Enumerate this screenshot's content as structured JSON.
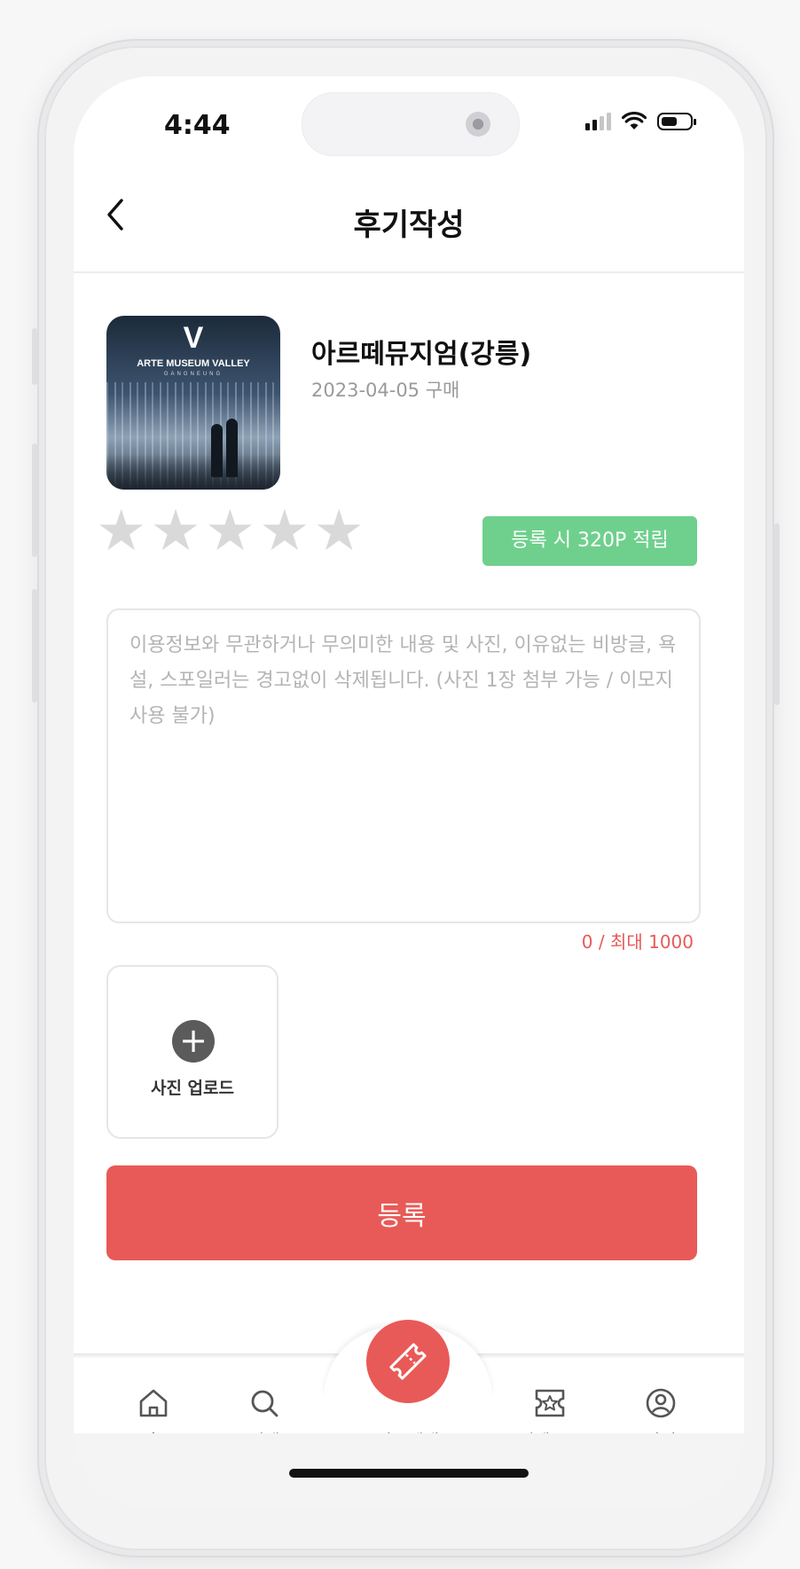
{
  "status_bar": {
    "time": "4:44"
  },
  "header": {
    "back_icon": "chevron-left-icon",
    "title": "후기작성"
  },
  "product": {
    "thumbnail_text": "ARTE MUSEUM VALLEY",
    "thumbnail_sub": "GANGNEUNG",
    "thumbnail_logo": "V",
    "name": "아르떼뮤지엄(강릉)",
    "purchase_date": "2023-04-05 구매"
  },
  "rating": {
    "stars_total": 5,
    "selected": 0,
    "star_color_empty": "#d9d9d9"
  },
  "points_badge": "등록 시 320P 적립",
  "review": {
    "placeholder": "이용정보와 무관하거나 무의미한 내용 및 사진, 이유없는 비방글, 욕설, 스포일러는 경고없이 삭제됩니다. (사진 1장 첨부 가능 / 이모지 사용 불가)",
    "char_count": "0 / 최대 1000"
  },
  "upload": {
    "icon": "plus-circle-icon",
    "label": "사진 업로드"
  },
  "submit_label": "등록",
  "tabbar": {
    "items": [
      {
        "label": "홈",
        "icon": "home-icon"
      },
      {
        "label": "검색",
        "icon": "search-icon"
      },
      {
        "label": "바로예매",
        "icon": "ticket-icon"
      },
      {
        "label": "티켓로그",
        "icon": "ticket-log-icon"
      },
      {
        "label": "마이",
        "icon": "user-icon"
      }
    ]
  },
  "colors": {
    "accent": "#e85a57",
    "badge": "#6fd08d",
    "muted": "#9a9a9a"
  }
}
